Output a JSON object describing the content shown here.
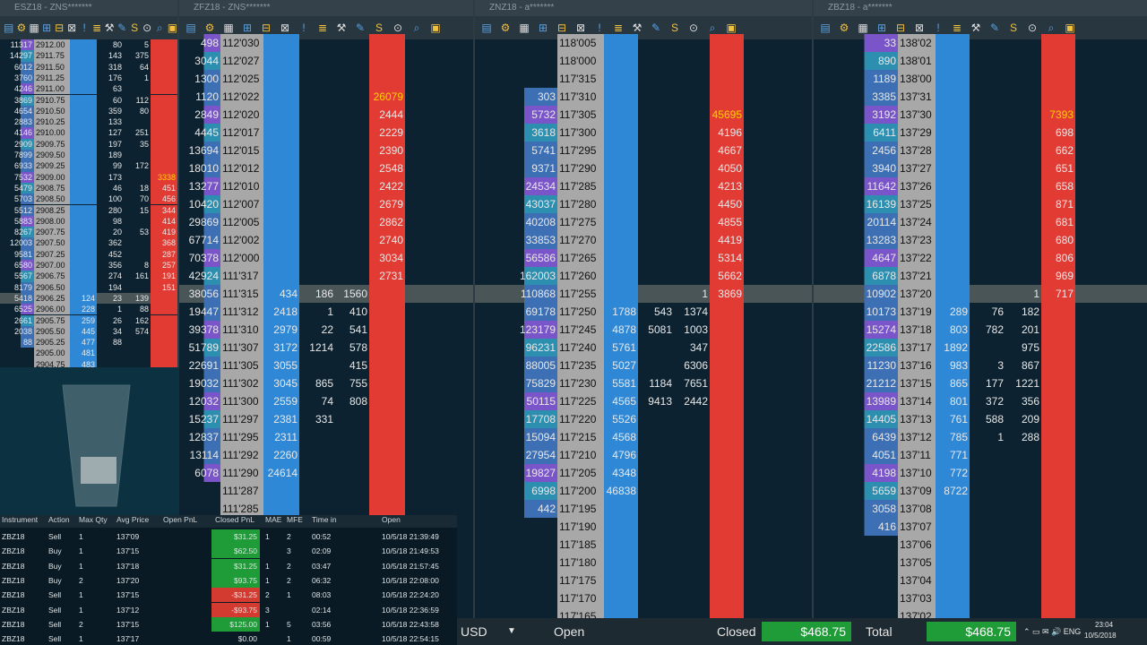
{
  "windows": {
    "es": {
      "title": "ESZ18 - ZNS*******",
      "rows": [
        [
          "11317",
          "2912.00",
          "",
          "80",
          "5",
          ""
        ],
        [
          "14297",
          "2911.75",
          "",
          "143",
          "375",
          ""
        ],
        [
          "6012",
          "2911.50",
          "",
          "318",
          "64",
          ""
        ],
        [
          "3760",
          "2911.25",
          "",
          "176",
          "1",
          ""
        ],
        [
          "4246",
          "2911.00",
          "",
          "63",
          "",
          ""
        ],
        [
          "3869",
          "2910.75",
          "",
          "60",
          "112",
          ""
        ],
        [
          "4654",
          "2910.50",
          "",
          "359",
          "80",
          ""
        ],
        [
          "2883",
          "2910.25",
          "",
          "133",
          "",
          ""
        ],
        [
          "4146",
          "2910.00",
          "",
          "127",
          "251",
          ""
        ],
        [
          "2909",
          "2909.75",
          "",
          "197",
          "35",
          ""
        ],
        [
          "7899",
          "2909.50",
          "",
          "189",
          "",
          ""
        ],
        [
          "6933",
          "2909.25",
          "",
          "99",
          "172",
          ""
        ],
        [
          "7532",
          "2909.00",
          "",
          "173",
          "",
          "3338"
        ],
        [
          "5479",
          "2908.75",
          "",
          "46",
          "18",
          "451"
        ],
        [
          "5703",
          "2908.50",
          "",
          "100",
          "70",
          "456"
        ],
        [
          "5512",
          "2908.25",
          "",
          "280",
          "15",
          "344"
        ],
        [
          "5883",
          "2908.00",
          "",
          "98",
          "",
          "414"
        ],
        [
          "8267",
          "2907.75",
          "",
          "20",
          "53",
          "419"
        ],
        [
          "12003",
          "2907.50",
          "",
          "362",
          "",
          "368"
        ],
        [
          "9581",
          "2907.25",
          "",
          "452",
          "",
          "287"
        ],
        [
          "6580",
          "2907.00",
          "",
          "356",
          "8",
          "257"
        ],
        [
          "5567",
          "2906.75",
          "",
          "274",
          "161",
          "191"
        ],
        [
          "8179",
          "2906.50",
          "",
          "194",
          "",
          "151"
        ],
        [
          "5418",
          "2906.25",
          "124",
          "23",
          "139",
          ""
        ],
        [
          "6525",
          "2906.00",
          "228",
          "1",
          "88",
          ""
        ],
        [
          "2661",
          "2905.75",
          "259",
          "26",
          "162",
          ""
        ],
        [
          "2038",
          "2905.50",
          "445",
          "34",
          "574",
          ""
        ],
        [
          "88",
          "2905.25",
          "477",
          "88",
          "",
          ""
        ],
        [
          "",
          "2905.00",
          "481",
          "",
          "",
          ""
        ],
        [
          "",
          "2904.75",
          "483",
          "",
          "",
          ""
        ]
      ]
    },
    "zf": {
      "title": "ZFZ18 - ZNS*******",
      "rows": [
        [
          "498",
          "112'030",
          "",
          "",
          "",
          ""
        ],
        [
          "3044",
          "112'027",
          "",
          "",
          "",
          ""
        ],
        [
          "1300",
          "112'025",
          "",
          "",
          "",
          ""
        ],
        [
          "1120",
          "112'022",
          "",
          "",
          "",
          "26079"
        ],
        [
          "2849",
          "112'020",
          "",
          "",
          "",
          "2444"
        ],
        [
          "4445",
          "112'017",
          "",
          "",
          "",
          "2229"
        ],
        [
          "13694",
          "112'015",
          "",
          "",
          "",
          "2390"
        ],
        [
          "18010",
          "112'012",
          "",
          "",
          "",
          "2548"
        ],
        [
          "13277",
          "112'010",
          "",
          "",
          "",
          "2422"
        ],
        [
          "10420",
          "112'007",
          "",
          "",
          "",
          "2679"
        ],
        [
          "29869",
          "112'005",
          "",
          "",
          "",
          "2862"
        ],
        [
          "67714",
          "112'002",
          "",
          "",
          "",
          "2740"
        ],
        [
          "70378",
          "112'000",
          "",
          "",
          "",
          "3034"
        ],
        [
          "42924",
          "111'317",
          "",
          "",
          "",
          "2731"
        ],
        [
          "38056",
          "111'315",
          "434",
          "186",
          "1560",
          ""
        ],
        [
          "19447",
          "111'312",
          "2418",
          "1",
          "410",
          ""
        ],
        [
          "39378",
          "111'310",
          "2979",
          "22",
          "541",
          ""
        ],
        [
          "51789",
          "111'307",
          "3172",
          "1214",
          "578",
          ""
        ],
        [
          "22691",
          "111'305",
          "3055",
          "",
          "415",
          ""
        ],
        [
          "19032",
          "111'302",
          "3045",
          "865",
          "755",
          ""
        ],
        [
          "12032",
          "111'300",
          "2559",
          "74",
          "808",
          ""
        ],
        [
          "15237",
          "111'297",
          "2381",
          "331",
          "",
          ""
        ],
        [
          "12837",
          "111'295",
          "2311",
          "",
          "",
          ""
        ],
        [
          "13114",
          "111'292",
          "2260",
          "",
          "",
          ""
        ],
        [
          "6078",
          "111'290",
          "24614",
          "",
          "",
          ""
        ],
        [
          "",
          "111'287",
          "",
          "",
          "",
          ""
        ],
        [
          "",
          "111'285",
          "",
          "",
          "",
          ""
        ]
      ]
    },
    "zn": {
      "title": "ZNZ18 - a*******",
      "rows": [
        [
          "",
          "118'005",
          "",
          "",
          "",
          ""
        ],
        [
          "",
          "118'000",
          "",
          "",
          "",
          ""
        ],
        [
          "",
          "117'315",
          "",
          "",
          "",
          ""
        ],
        [
          "303",
          "117'310",
          "",
          "",
          "",
          ""
        ],
        [
          "5732",
          "117'305",
          "",
          "",
          "",
          "45695"
        ],
        [
          "3618",
          "117'300",
          "",
          "",
          "",
          "4196"
        ],
        [
          "5741",
          "117'295",
          "",
          "",
          "",
          "4667"
        ],
        [
          "9371",
          "117'290",
          "",
          "",
          "",
          "4050"
        ],
        [
          "24534",
          "117'285",
          "",
          "",
          "",
          "4213"
        ],
        [
          "43037",
          "117'280",
          "",
          "",
          "",
          "4450"
        ],
        [
          "40208",
          "117'275",
          "",
          "",
          "",
          "4855"
        ],
        [
          "33853",
          "117'270",
          "",
          "",
          "",
          "4419"
        ],
        [
          "56586",
          "117'265",
          "",
          "",
          "",
          "5314"
        ],
        [
          "162003",
          "117'260",
          "",
          "",
          "",
          "5662"
        ],
        [
          "110868",
          "117'255",
          "",
          "",
          "1",
          "3869"
        ],
        [
          "69178",
          "117'250",
          "1788",
          "543",
          "1374",
          ""
        ],
        [
          "123179",
          "117'245",
          "4878",
          "5081",
          "1003",
          ""
        ],
        [
          "96231",
          "117'240",
          "5761",
          "",
          "347",
          ""
        ],
        [
          "88005",
          "117'235",
          "5027",
          "",
          "6306",
          ""
        ],
        [
          "75829",
          "117'230",
          "5581",
          "1184",
          "7651",
          ""
        ],
        [
          "50115",
          "117'225",
          "4565",
          "9413",
          "2442",
          ""
        ],
        [
          "17708",
          "117'220",
          "5526",
          "",
          "",
          ""
        ],
        [
          "15094",
          "117'215",
          "4568",
          "",
          "",
          ""
        ],
        [
          "27954",
          "117'210",
          "4796",
          "",
          "",
          ""
        ],
        [
          "19827",
          "117'205",
          "4348",
          "",
          "",
          ""
        ],
        [
          "6998",
          "117'200",
          "46838",
          "",
          "",
          ""
        ],
        [
          "442",
          "117'195",
          "",
          "",
          "",
          ""
        ],
        [
          "",
          "117'190",
          "",
          "",
          "",
          ""
        ],
        [
          "",
          "117'185",
          "",
          "",
          "",
          ""
        ],
        [
          "",
          "117'180",
          "",
          "",
          "",
          ""
        ],
        [
          "",
          "117'175",
          "",
          "",
          "",
          ""
        ],
        [
          "",
          "117'170",
          "",
          "",
          "",
          ""
        ],
        [
          "",
          "117'165",
          "",
          "",
          "",
          ""
        ]
      ]
    },
    "zb": {
      "title": "ZBZ18 - a*******",
      "rows": [
        [
          "33",
          "138'02",
          "",
          "",
          "",
          ""
        ],
        [
          "890",
          "138'01",
          "",
          "",
          "",
          ""
        ],
        [
          "1189",
          "138'00",
          "",
          "",
          "",
          ""
        ],
        [
          "3385",
          "137'31",
          "",
          "",
          "",
          ""
        ],
        [
          "3192",
          "137'30",
          "",
          "",
          "",
          "7393"
        ],
        [
          "6411",
          "137'29",
          "",
          "",
          "",
          "698"
        ],
        [
          "2456",
          "137'28",
          "",
          "",
          "",
          "662"
        ],
        [
          "3940",
          "137'27",
          "",
          "",
          "",
          "651"
        ],
        [
          "11642",
          "137'26",
          "",
          "",
          "",
          "658"
        ],
        [
          "16139",
          "137'25",
          "",
          "",
          "",
          "871"
        ],
        [
          "20114",
          "137'24",
          "",
          "",
          "",
          "681"
        ],
        [
          "13283",
          "137'23",
          "",
          "",
          "",
          "680"
        ],
        [
          "4647",
          "137'22",
          "",
          "",
          "",
          "806"
        ],
        [
          "6878",
          "137'21",
          "",
          "",
          "",
          "969"
        ],
        [
          "10902",
          "137'20",
          "",
          "",
          "1",
          "717"
        ],
        [
          "10173",
          "137'19",
          "289",
          "76",
          "182",
          ""
        ],
        [
          "15274",
          "137'18",
          "803",
          "782",
          "201",
          ""
        ],
        [
          "22586",
          "137'17",
          "1892",
          "",
          "975",
          ""
        ],
        [
          "11230",
          "137'16",
          "983",
          "3",
          "867",
          ""
        ],
        [
          "21212",
          "137'15",
          "865",
          "177",
          "1221",
          ""
        ],
        [
          "13989",
          "137'14",
          "801",
          "372",
          "356",
          ""
        ],
        [
          "14405",
          "137'13",
          "761",
          "588",
          "209",
          ""
        ],
        [
          "6439",
          "137'12",
          "785",
          "1",
          "288",
          ""
        ],
        [
          "4051",
          "137'11",
          "771",
          "",
          "",
          ""
        ],
        [
          "4198",
          "137'10",
          "772",
          "",
          "",
          ""
        ],
        [
          "5659",
          "137'09",
          "8722",
          "",
          "",
          ""
        ],
        [
          "3058",
          "137'08",
          "",
          "",
          "",
          ""
        ],
        [
          "416",
          "137'07",
          "",
          "",
          "",
          ""
        ],
        [
          "",
          "137'06",
          "",
          "",
          "",
          ""
        ],
        [
          "",
          "137'05",
          "",
          "",
          "",
          ""
        ],
        [
          "",
          "137'04",
          "",
          "",
          "",
          ""
        ],
        [
          "",
          "137'03",
          "",
          "",
          "",
          ""
        ],
        [
          "",
          "137'02",
          "",
          "",
          "",
          ""
        ]
      ]
    }
  },
  "trades": {
    "headers": [
      "Instrument",
      "Action",
      "Max Qty",
      "Avg Price",
      "Open PnL",
      "Closed PnL",
      "MAE",
      "MFE",
      "Time in",
      "Open"
    ],
    "rows": [
      [
        "ZBZ18",
        "Sell",
        "1",
        "137'09",
        "",
        "$31.25",
        "1",
        "2",
        "00:52",
        "10/5/18 21:39:49"
      ],
      [
        "ZBZ18",
        "Buy",
        "1",
        "137'15",
        "",
        "$62.50",
        "",
        "3",
        "02:09",
        "10/5/18 21:49:53"
      ],
      [
        "ZBZ18",
        "Buy",
        "1",
        "137'18",
        "",
        "$31.25",
        "1",
        "2",
        "03:47",
        "10/5/18 21:57:45"
      ],
      [
        "ZBZ18",
        "Buy",
        "2",
        "137'20",
        "",
        "$93.75",
        "1",
        "2",
        "06:32",
        "10/5/18 22:08:00"
      ],
      [
        "ZBZ18",
        "Sell",
        "1",
        "137'15",
        "",
        "-$31.25",
        "2",
        "1",
        "08:03",
        "10/5/18 22:24:20"
      ],
      [
        "ZBZ18",
        "Sell",
        "1",
        "137'12",
        "",
        "-$93.75",
        "3",
        "",
        "02:14",
        "10/5/18 22:36:59"
      ],
      [
        "ZBZ18",
        "Sell",
        "2",
        "137'15",
        "",
        "$125.00",
        "1",
        "5",
        "03:56",
        "10/5/18 22:43:58"
      ],
      [
        "ZBZ18",
        "Sell",
        "1",
        "137'17",
        "",
        "$0.00",
        "",
        "1",
        "00:59",
        "10/5/18 22:54:15"
      ]
    ]
  },
  "status": {
    "currency": "USD",
    "open_label": "Open",
    "closed_label": "Closed",
    "closed_value": "$468.75",
    "total_label": "Total",
    "total_value": "$468.75",
    "tray": "⌃ ▭ ✉ 🔊 ENG",
    "time": "23:04",
    "date": "10/5/2018"
  },
  "colors": {
    "bid": "#2f88d6",
    "ask": "#e23b34",
    "ladder_bg": "#0c2230",
    "price_bg": "#1b1b1b",
    "inside_row": "#4a5558"
  }
}
